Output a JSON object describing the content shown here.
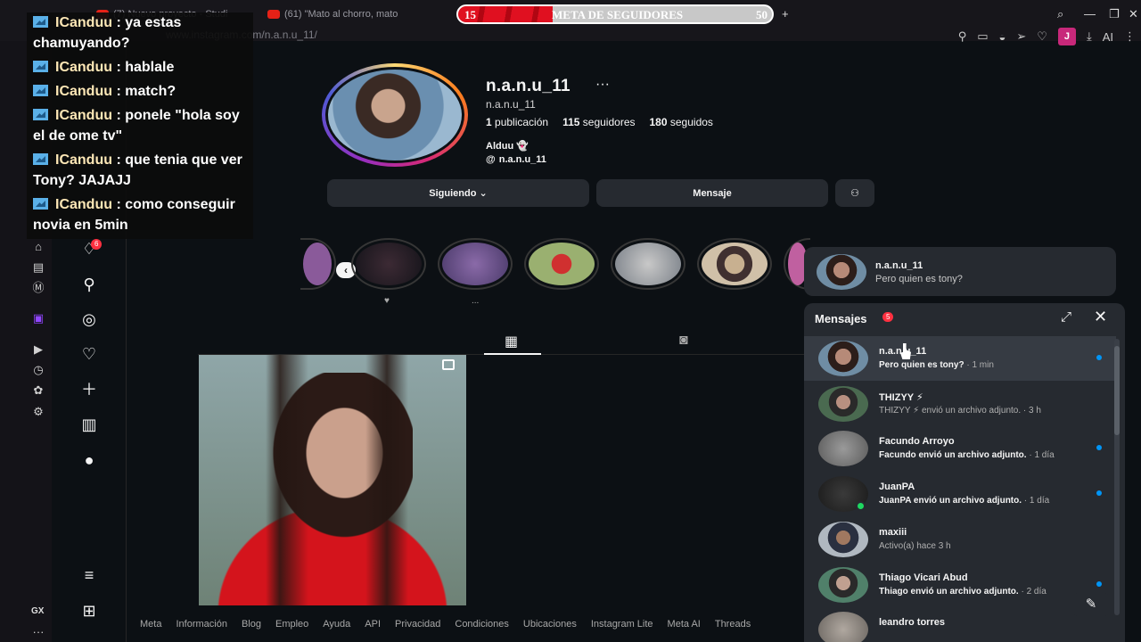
{
  "browser": {
    "tabs": [
      {
        "label": "(7) Nuevo proyecto - Studi"
      },
      {
        "label": "(61) \"Mato al chorro, mato"
      }
    ],
    "url": "www.instagram.com/n.a.n.u_11/",
    "profile_initial": "J",
    "ai_label": "AI"
  },
  "goal": {
    "title": "META DE SEGUIDORES",
    "current": "15",
    "target": "50",
    "progress_fraction": 0.3
  },
  "gx": {
    "label": "GX"
  },
  "chat": {
    "messages": [
      {
        "user": "ICanduu",
        "text": " : ya estas chamuyando?"
      },
      {
        "user": "ICanduu",
        "text": " : hablale"
      },
      {
        "user": "ICanduu",
        "text": " : match?"
      },
      {
        "user": "ICanduu",
        "text": " : ponele \"hola soy el de ome tv\""
      },
      {
        "user": "ICanduu",
        "text": " : que tenia que ver Tony? JAJAJJ"
      },
      {
        "user": "ICanduu",
        "text": " : como conseguir novia en 5min"
      }
    ]
  },
  "nav": {
    "notifications_badge": "6"
  },
  "profile": {
    "username": "n.a.n.u_11",
    "more": "···",
    "handle": "n.a.n.u_11",
    "posts_count": "1",
    "posts_label": "publicación",
    "followers_count": "115",
    "followers_label": "seguidores",
    "following_count": "180",
    "following_label": "seguidos",
    "bio_name": "Alduu",
    "threads_handle": "n.a.n.u_11",
    "following_button": "Siguiendo",
    "message_button": "Mensaje"
  },
  "highlights": [
    {
      "caption": "♥"
    },
    {
      "caption": "..."
    },
    {
      "caption": ""
    },
    {
      "caption": ""
    },
    {
      "caption": ""
    },
    {
      "caption": ""
    }
  ],
  "toast": {
    "name": "n.a.n.u_11",
    "text": "Pero quien es tony?"
  },
  "messages": {
    "title": "Mensajes",
    "count": "5",
    "conversations": [
      {
        "name": "n.a.n.u_11",
        "preview": "Pero quien es tony?",
        "time": " · 1 min",
        "unread": true,
        "bold": true
      },
      {
        "name": "THIZYY ⚡",
        "preview": "THIZYY ⚡ envió un archivo adjunto.",
        "time": " · 3 h",
        "unread": false,
        "bold": false
      },
      {
        "name": "Facundo Arroyo",
        "preview": "Facundo envió un archivo adjunto.",
        "time": " · 1 día",
        "unread": true,
        "bold": true
      },
      {
        "name": "JuanPA",
        "preview": "JuanPA envió un archivo adjunto.",
        "time": " · 1 día",
        "unread": true,
        "bold": true
      },
      {
        "name": "maxiii",
        "preview": "Activo(a) hace 3 h",
        "time": "",
        "unread": false,
        "bold": false
      },
      {
        "name": "Thiago Vicari Abud",
        "preview": "Thiago envió un archivo adjunto.",
        "time": " · 2 día",
        "unread": true,
        "bold": true
      },
      {
        "name": "leandro torres",
        "preview": "",
        "time": "",
        "unread": false,
        "bold": false
      }
    ]
  },
  "footer": {
    "links": [
      "Meta",
      "Información",
      "Blog",
      "Empleo",
      "Ayuda",
      "API",
      "Privacidad",
      "Condiciones",
      "Ubicaciones",
      "Instagram Lite",
      "Meta AI",
      "Threads"
    ]
  },
  "colors": {
    "accent_unread": "#0095f6",
    "badge_red": "#ff3040",
    "panel_bg": "#262a30",
    "page_bg": "#0c1014"
  }
}
